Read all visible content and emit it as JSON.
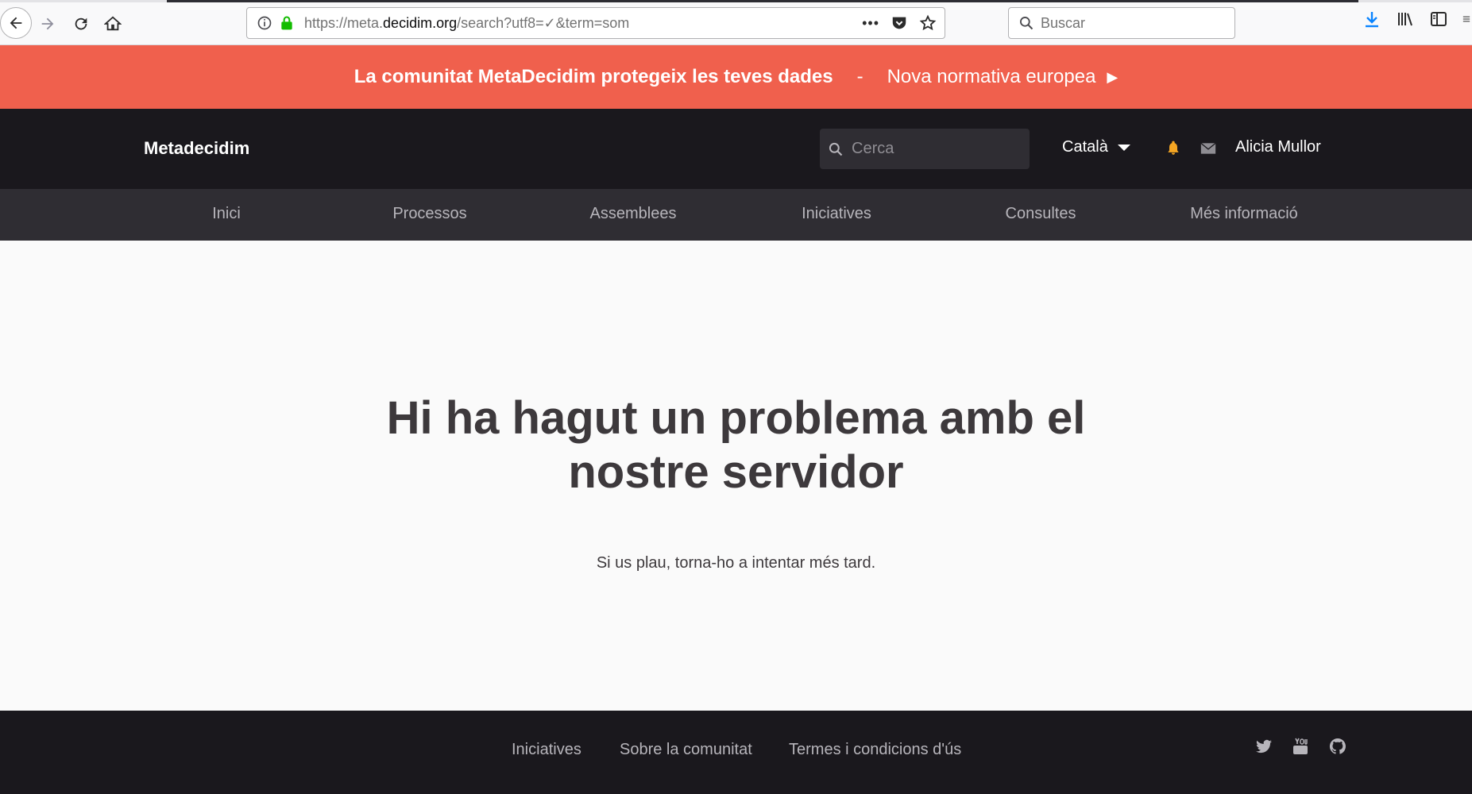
{
  "browser": {
    "url_prefix": "https://meta.",
    "url_host": "decidim.org",
    "url_suffix": "/search?utf8=✓&term=som",
    "search_placeholder": "Buscar",
    "actions_more": "•••"
  },
  "banner": {
    "bold_text": "La comunitat MetaDecidim protegeix les teves dades",
    "separator": "-",
    "link_text": "Nova normativa europea",
    "arrow": "▶"
  },
  "header": {
    "logo": "Metadecidim",
    "search_placeholder": "Cerca",
    "language": "Català",
    "user_name": "Alicia Mullor"
  },
  "nav": {
    "items": [
      "Inici",
      "Processos",
      "Assemblees",
      "Iniciatives",
      "Consultes",
      "Més informació"
    ]
  },
  "error": {
    "title_line1": "Hi ha hagut un problema amb el",
    "title_line2": "nostre servidor",
    "message": "Si us plau, torna-ho a intentar més tard."
  },
  "footer": {
    "links": [
      "Iniciatives",
      "Sobre la comunitat",
      "Termes i condicions d'ús"
    ]
  },
  "colors": {
    "banner": "#f0604d",
    "header": "#1a181d",
    "nav": "#2f2d33",
    "bell": "#f5a623"
  }
}
